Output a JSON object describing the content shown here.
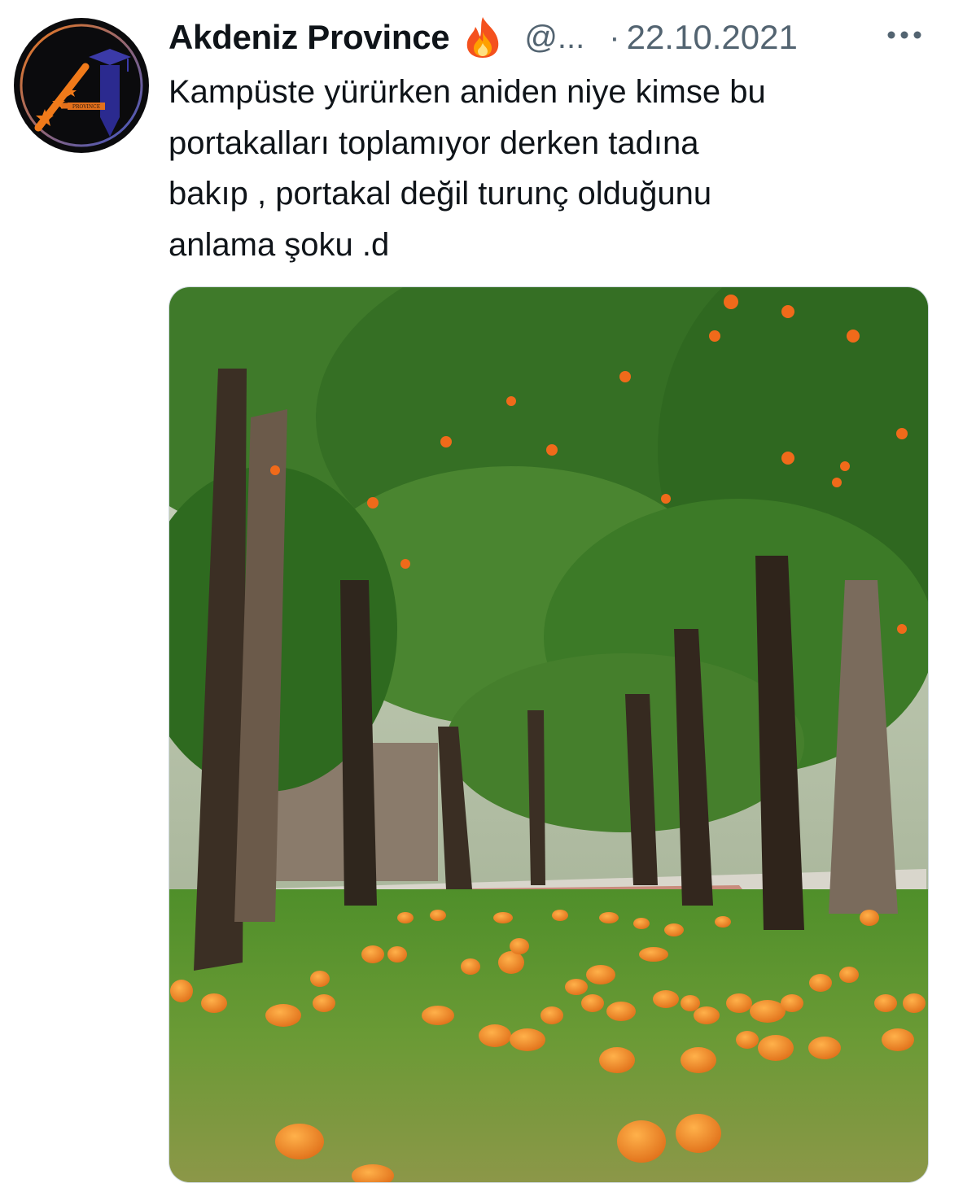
{
  "tweet": {
    "author_name": "Akdeniz Province",
    "author_emoji": "fire-emoji",
    "handle": "@...",
    "separator": "·",
    "date": "22.10.2021",
    "text_lines": [
      "Kampüste yürürken aniden niye kimse bu",
      "portakalları toplamıyor derken tadına",
      "bakıp , portakal değil turunç olduğunu",
      "anlama şoku .d"
    ],
    "avatar_logo_text": "PROVINCE",
    "media_alt_icon": "photo-orange-trees"
  },
  "colors": {
    "text_primary": "#0f1419",
    "text_secondary": "#536471",
    "brand_orange": "#f07a1a",
    "brand_purple": "#2b2a8f"
  }
}
